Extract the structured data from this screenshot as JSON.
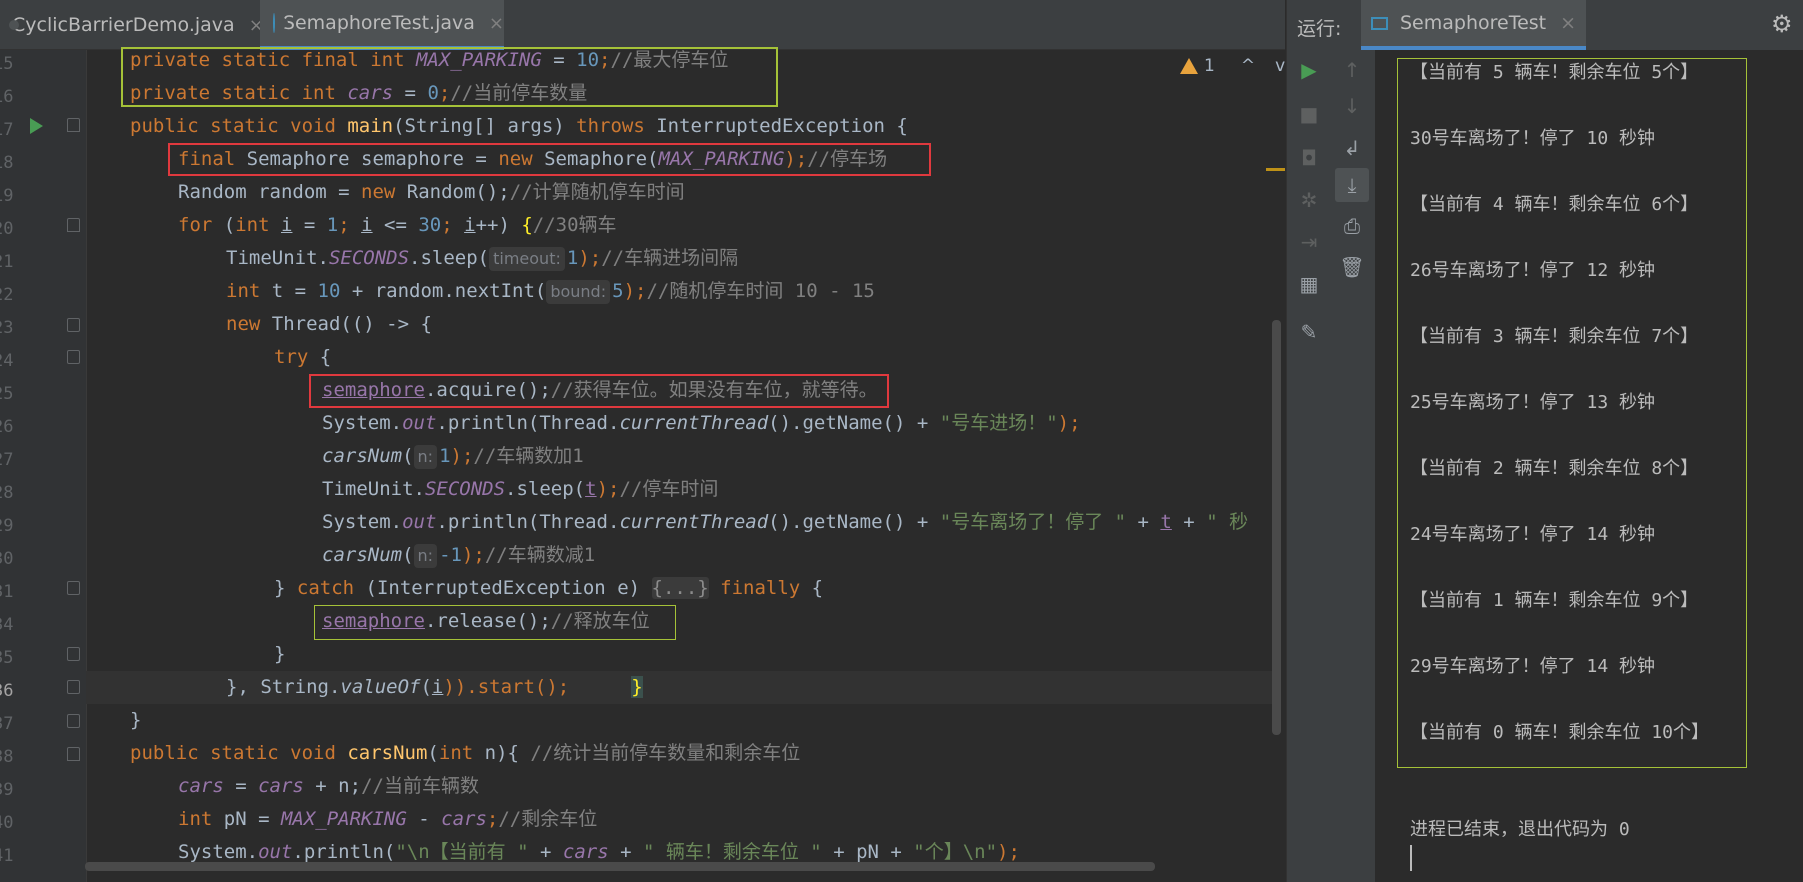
{
  "tabs": [
    {
      "label": "CyclicBarrierDemo.java",
      "close": "×"
    },
    {
      "label": "SemaphoreTest.java",
      "close": "×"
    }
  ],
  "warnings": {
    "count": "1",
    "up": "^",
    "down": "v"
  },
  "line_numbers": [
    "15",
    "16",
    "17",
    "18",
    "19",
    "20",
    "21",
    "22",
    "23",
    "24",
    "25",
    "26",
    "27",
    "28",
    "29",
    "30",
    "31",
    "34",
    "35",
    "36",
    "37",
    "38",
    "39",
    "40",
    "41"
  ],
  "code": {
    "l1_kw": "private static final int ",
    "l1_const": "MAX_PARKING",
    "l1_eq": " = ",
    "l1_num": "10",
    "l1_semi": ";",
    "l1_cm": "//最大停车位",
    "l2_kw": "private static int ",
    "l2_fld": "cars",
    "l2_eq": " = ",
    "l2_num": "0",
    "l2_semi": ";",
    "l2_cm": "//当前停车数量",
    "l3_kw1": "public static void ",
    "l3_fn": "main",
    "l3_mid": "(String[] args) ",
    "l3_kw2": "throws ",
    "l3_end": "InterruptedException {",
    "l4_kw1": "final ",
    "l4_mid": "Semaphore semaphore = ",
    "l4_kw2": "new ",
    "l4_cls": "Semaphore(",
    "l4_const": "MAX_PARKING",
    "l4_end": ");",
    "l4_cm": "//停车场",
    "l5_a": "Random random = ",
    "l5_kw": "new ",
    "l5_b": "Random();",
    "l5_cm": "//计算随机停车时间",
    "l6_kw": "for ",
    "l6_a": "(",
    "l6_kw2": "int ",
    "l6_i1": "i",
    "l6_b": " = ",
    "l6_n1": "1",
    "l6_c": "; ",
    "l6_i2": "i",
    "l6_d": " <= ",
    "l6_n2": "30",
    "l6_e": "; ",
    "l6_i3": "i",
    "l6_f": "++) ",
    "l6_brace": "{",
    "l6_cm": "//30辆车",
    "l7_a": "TimeUnit.",
    "l7_st": "SECONDS",
    "l7_b": ".sleep(",
    "l7_hint": "timeout:",
    "l7_num": "1",
    "l7_c": ");",
    "l7_cm": "//车辆进场间隔",
    "l8_kw": "int ",
    "l8_a": "t = ",
    "l8_n1": "10",
    "l8_b": " + random.nextInt(",
    "l8_hint": "bound:",
    "l8_n2": "5",
    "l8_c": ");",
    "l8_cm": "//随机停车时间 10 - 15",
    "l9_kw": "new ",
    "l9_a": "Thread(() -> {",
    "l10_kw": "try ",
    "l10_a": "{",
    "l11_fld": "semaphore",
    "l11_a": ".acquire();",
    "l11_cm": "//获得车位。如果没有车位，就等待。",
    "l12_a": "System.",
    "l12_st": "out",
    "l12_b": ".println(Thread.",
    "l12_it": "currentThread",
    "l12_c": "().getName() + ",
    "l12_str": "\"号车进场！\"",
    "l12_d": ");",
    "l13_it": "carsNum",
    "l13_a": "(",
    "l13_hint": "n:",
    "l13_num": "1",
    "l13_b": ");",
    "l13_cm": "//车辆数加1",
    "l14_a": "TimeUnit.",
    "l14_st": "SECONDS",
    "l14_b": ".sleep(",
    "l14_t": "t",
    "l14_c": ");",
    "l14_cm": "//停车时间",
    "l15_a": "System.",
    "l15_st": "out",
    "l15_b": ".println(Thread.",
    "l15_it": "currentThread",
    "l15_c": "().getName() + ",
    "l15_str1": "\"号车离场了！停了 \"",
    "l15_d": " + ",
    "l15_t": "t",
    "l15_e": " + ",
    "l15_str2": "\" 秒",
    "l16_it": "carsNum",
    "l16_a": "(",
    "l16_hint": "n:",
    "l16_num": "-1",
    "l16_b": ");",
    "l16_cm": "//车辆数减1",
    "l17_a": "} ",
    "l17_kw": "catch ",
    "l17_b": "(InterruptedException e) ",
    "l17_coll": "{...}",
    "l17_kw2": " finally ",
    "l17_c": "{",
    "l18_fld": "semaphore",
    "l18_a": ".release();",
    "l18_cm": "//释放车位",
    "l19_a": "}",
    "l20_a": "}, String.",
    "l20_it": "valueOf",
    "l20_b": "(",
    "l20_i": "i",
    "l20_c": ")).start();",
    "l20_brace": "}",
    "l21_a": "}",
    "l22_kw1": "public static void ",
    "l22_fn": "carsNum",
    "l22_a": "(",
    "l22_kw2": "int ",
    "l22_b": "n){ ",
    "l22_cm": "//统计当前停车数量和剩余车位",
    "l23_fld1": "cars",
    "l23_a": " = ",
    "l23_fld2": "cars",
    "l23_b": " + n;",
    "l23_cm": "//当前车辆数",
    "l24_kw": "int ",
    "l24_a": "pN = ",
    "l24_const": "MAX_PARKING",
    "l24_b": " - ",
    "l24_fld": "cars",
    "l24_c": ";",
    "l24_cm": "//剩余车位",
    "l25_a": "System.",
    "l25_st": "out",
    "l25_b": ".println(",
    "l25_str1": "\"\\n【当前有 \"",
    "l25_c": " + ",
    "l25_fld": "cars",
    "l25_d": " + ",
    "l25_str2": "\" 辆车！剩余车位 \"",
    "l25_e": " + pN + ",
    "l25_str3": "\"个】\\n\"",
    "l25_f": ");"
  },
  "run": {
    "label": "运行:",
    "tab": "SemaphoreTest",
    "close": "×",
    "gear": "⚙"
  },
  "console": {
    "lines": [
      "【当前有 5 辆车！剩余车位 5个】",
      "30号车离场了！停了 10 秒钟",
      "【当前有 4 辆车！剩余车位 6个】",
      "26号车离场了！停了 12 秒钟",
      "【当前有 3 辆车！剩余车位 7个】",
      "25号车离场了！停了 13 秒钟",
      "【当前有 2 辆车！剩余车位 8个】",
      "24号车离场了！停了 14 秒钟",
      "【当前有 1 辆车！剩余车位 9个】",
      "29号车离场了！停了 14 秒钟",
      "【当前有 0 辆车！剩余车位 10个】"
    ],
    "exit": "进程已结束，退出代码为 0"
  },
  "colors": {
    "keyword": "#cc7832",
    "field": "#9876aa",
    "number": "#6897bb",
    "comment": "#808080",
    "string": "#6a8759",
    "method": "#ffc66d",
    "highlight_green": "#a5c238",
    "highlight_red": "#e0393e"
  }
}
